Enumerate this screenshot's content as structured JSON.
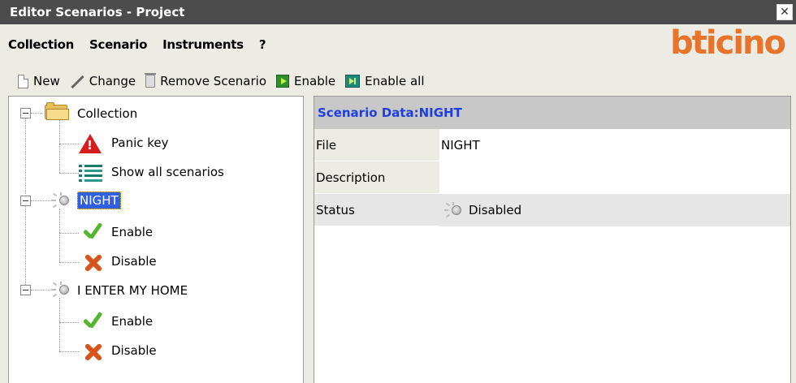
{
  "window": {
    "title": "Editor Scenarios - Project",
    "close_label": "✕"
  },
  "menubar": {
    "items": [
      {
        "label": "Collection"
      },
      {
        "label": "Scenario"
      },
      {
        "label": "Instruments"
      },
      {
        "label": "?"
      }
    ],
    "brand": "bticino"
  },
  "toolbar": {
    "new_label": "New",
    "change_label": "Change",
    "remove_label": "Remove Scenario",
    "enable_label": "Enable",
    "enable_all_label": "Enable all"
  },
  "tree": {
    "collection": {
      "label": "Collection",
      "children": [
        {
          "label": "Panic key"
        },
        {
          "label": "Show all scenarios"
        }
      ]
    },
    "scenarios": [
      {
        "label": "NIGHT",
        "selected": true,
        "children": [
          {
            "label": "Enable"
          },
          {
            "label": "Disable"
          }
        ]
      },
      {
        "label": "I ENTER MY HOME",
        "selected": false,
        "children": [
          {
            "label": "Enable"
          },
          {
            "label": "Disable"
          }
        ]
      }
    ]
  },
  "details": {
    "header": "Scenario Data:NIGHT",
    "rows": [
      {
        "key": "File",
        "value": "NIGHT"
      },
      {
        "key": "Description",
        "value": ""
      },
      {
        "key": "Status",
        "value": "Disabled"
      }
    ]
  },
  "colors": {
    "brand": "#e8732a",
    "header_text": "#1e3ee0",
    "selection": "#3060e0",
    "titlebar": "#4c4c4c"
  },
  "icons": [
    "folder-icon",
    "warning-icon",
    "list-icon",
    "bulb-icon",
    "check-icon",
    "x-icon",
    "new-file-icon",
    "pencil-icon",
    "trash-icon",
    "enable-icon",
    "enable-all-icon"
  ]
}
